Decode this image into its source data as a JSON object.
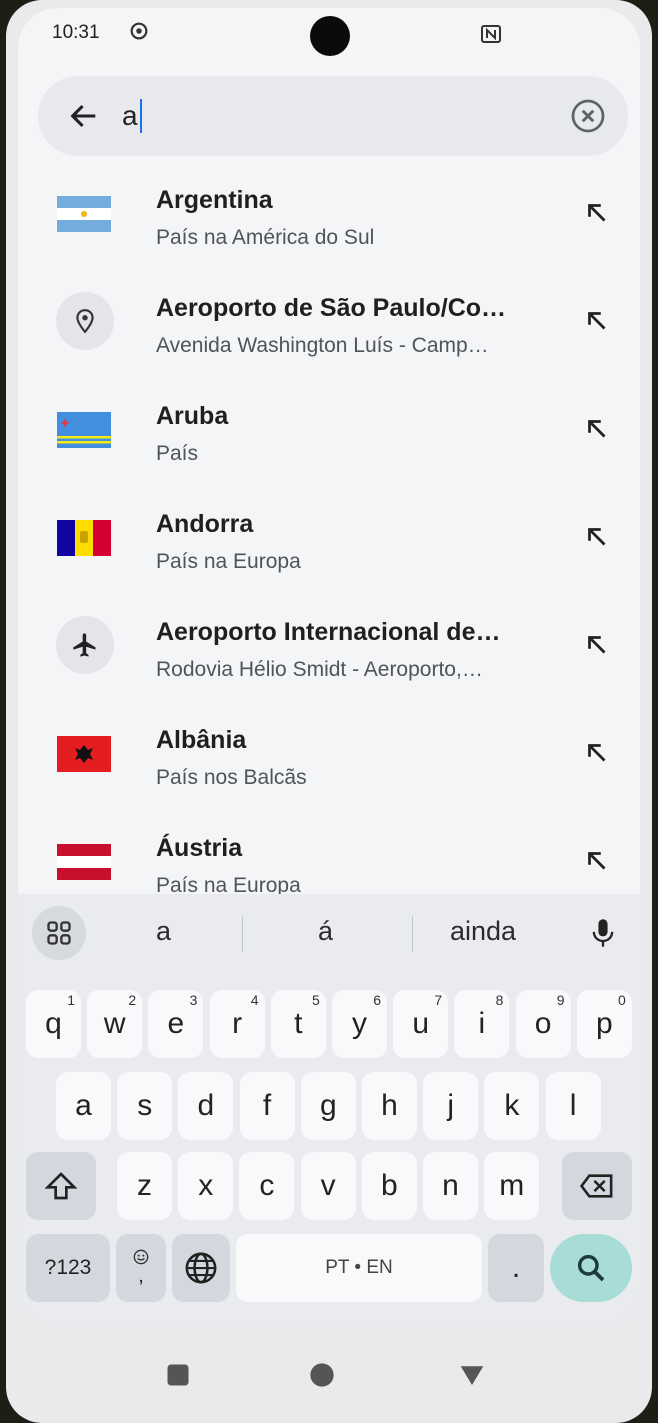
{
  "status_bar": {
    "time": "10:31"
  },
  "search": {
    "query": "a"
  },
  "results": [
    {
      "title": "Argentina",
      "subtitle": "País na América do Sul",
      "icon": "flag-argentina-icon"
    },
    {
      "title": "Aeroporto de São Paulo/Co…",
      "subtitle": "Avenida Washington Luís - Camp…",
      "icon": "location-pin-icon"
    },
    {
      "title": "Aruba",
      "subtitle": "País",
      "icon": "flag-aruba-icon"
    },
    {
      "title": "Andorra",
      "subtitle": "País na Europa",
      "icon": "flag-andorra-icon"
    },
    {
      "title": "Aeroporto Internacional de…",
      "subtitle": "Rodovia Hélio Smidt - Aeroporto,…",
      "icon": "airplane-icon"
    },
    {
      "title": "Albânia",
      "subtitle": "País nos Balcãs",
      "icon": "flag-albania-icon"
    },
    {
      "title": "Áustria",
      "subtitle": "País na Europa",
      "icon": "flag-austria-icon"
    }
  ],
  "suggestions": [
    "a",
    "á",
    "ainda"
  ],
  "keyboard": {
    "row1": [
      {
        "k": "q",
        "n": "1"
      },
      {
        "k": "w",
        "n": "2"
      },
      {
        "k": "e",
        "n": "3"
      },
      {
        "k": "r",
        "n": "4"
      },
      {
        "k": "t",
        "n": "5"
      },
      {
        "k": "y",
        "n": "6"
      },
      {
        "k": "u",
        "n": "7"
      },
      {
        "k": "i",
        "n": "8"
      },
      {
        "k": "o",
        "n": "9"
      },
      {
        "k": "p",
        "n": "0"
      }
    ],
    "row2": [
      "a",
      "s",
      "d",
      "f",
      "g",
      "h",
      "j",
      "k",
      "l"
    ],
    "row3": [
      "z",
      "x",
      "c",
      "v",
      "b",
      "n",
      "m"
    ],
    "symbols_label": "?123",
    "emoji_comma": ",",
    "space_label": "PT • EN",
    "period": "."
  },
  "colors": {
    "accent": "#1a73e8",
    "search_key": "#a8dcd6",
    "background": "#f4f5f7"
  }
}
